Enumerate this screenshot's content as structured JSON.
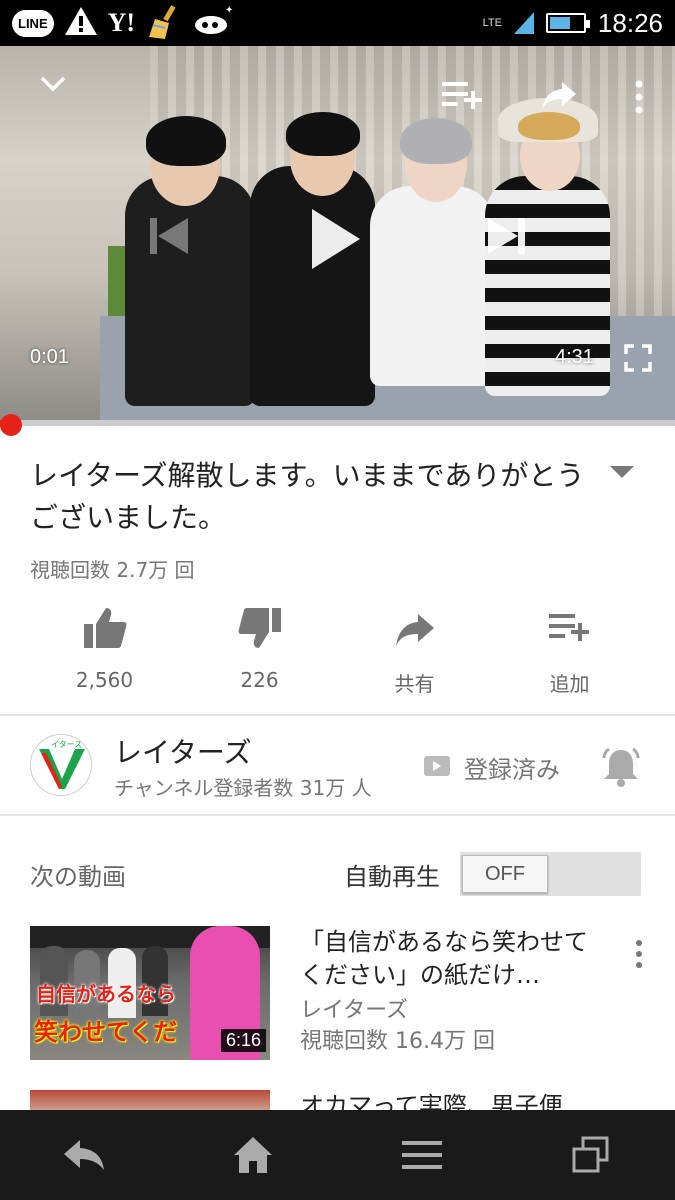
{
  "status_bar": {
    "app_badges": [
      "LINE",
      "Y!"
    ],
    "network": "LTE",
    "battery_level": 0.55,
    "time": "18:26"
  },
  "player": {
    "current_time": "0:01",
    "duration": "4:31",
    "progress": 0.004,
    "accent_color": "#e62117"
  },
  "video": {
    "title": "レイターズ解散します。いままでありがとうございました。",
    "views": "視聴回数 2.7万 回"
  },
  "actions": {
    "like_count": "2,560",
    "dislike_count": "226",
    "share_label": "共有",
    "add_label": "追加"
  },
  "channel": {
    "name": "レイターズ",
    "subscribers": "チャンネル登録者数 31万 人",
    "subscribe_status": "登録済み",
    "avatar_text": "イターズ"
  },
  "up_next": {
    "heading": "次の動画",
    "autoplay_label": "自動再生",
    "autoplay_state": "OFF",
    "items": [
      {
        "title": "「自信があるなら笑わせてください」の紙だけ…",
        "channel": "レイターズ",
        "views": "視聴回数 16.4万 回",
        "duration": "6:16",
        "thumb_caption_1": "自信があるなら",
        "thumb_caption_2": "笑わせてくだ"
      },
      {
        "title": "オカマって実際、男子便"
      }
    ]
  },
  "icons": {
    "status": [
      "line-icon",
      "warning-icon",
      "yahoo-icon",
      "broom-icon",
      "spaceship-icon",
      "signal-icon",
      "battery-icon"
    ],
    "player": [
      "chevron-down-icon",
      "add-to-playlist-icon",
      "share-icon",
      "more-vert-icon",
      "previous-icon",
      "play-icon",
      "next-icon",
      "fullscreen-icon"
    ],
    "nav": [
      "back-icon",
      "home-icon",
      "menu-icon",
      "recent-apps-icon"
    ]
  }
}
